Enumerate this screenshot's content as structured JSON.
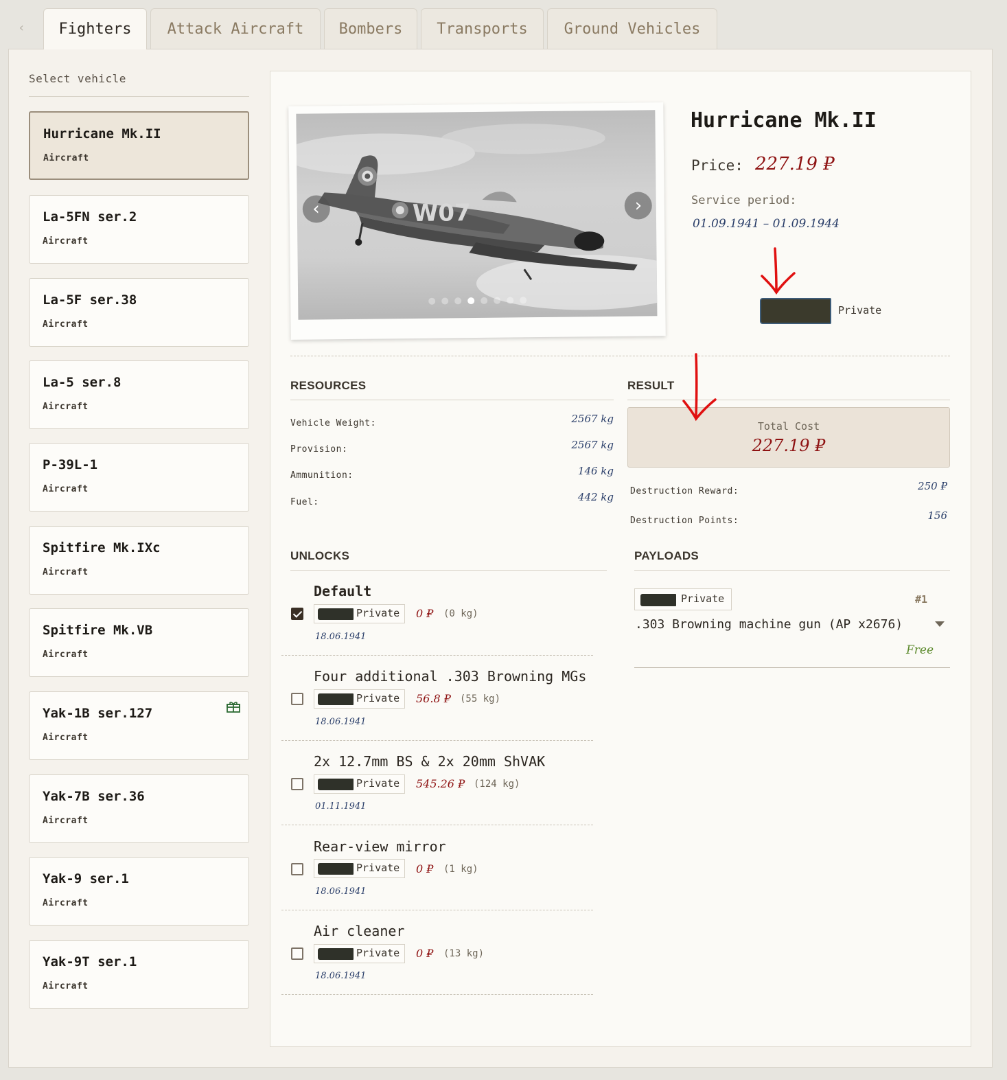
{
  "tabs": [
    {
      "label": "Fighters",
      "active": true
    },
    {
      "label": "Attack Aircraft",
      "active": false
    },
    {
      "label": "Bombers",
      "active": false
    },
    {
      "label": "Transports",
      "active": false
    },
    {
      "label": "Ground Vehicles",
      "active": false
    }
  ],
  "sidebar": {
    "heading": "Select vehicle",
    "vehicles": [
      {
        "name": "Hurricane Mk.II",
        "type": "Aircraft",
        "selected": true
      },
      {
        "name": "La-5FN ser.2",
        "type": "Aircraft"
      },
      {
        "name": "La-5F ser.38",
        "type": "Aircraft"
      },
      {
        "name": "La-5 ser.8",
        "type": "Aircraft"
      },
      {
        "name": "P-39L-1",
        "type": "Aircraft"
      },
      {
        "name": "Spitfire Mk.IXc",
        "type": "Aircraft"
      },
      {
        "name": "Spitfire Mk.VB",
        "type": "Aircraft"
      },
      {
        "name": "Yak-1B ser.127",
        "type": "Aircraft",
        "icon": "gift-icon"
      },
      {
        "name": "Yak-7B ser.36",
        "type": "Aircraft"
      },
      {
        "name": "Yak-9 ser.1",
        "type": "Aircraft"
      },
      {
        "name": "Yak-9T ser.1",
        "type": "Aircraft"
      }
    ]
  },
  "detail": {
    "title": "Hurricane Mk.II",
    "price_label": "Price:",
    "price_value": "227.19 ₽",
    "service_label": "Service period:",
    "service_value": "01.09.1941 – 01.09.1944",
    "rank_label": "Private",
    "gallery_slides": 8,
    "gallery_active_slide": 4
  },
  "resources": {
    "heading": "RESOURCES",
    "rows": [
      {
        "label": "Vehicle Weight:",
        "value": "2567 kg"
      },
      {
        "label": "Provision:",
        "value": "2567 kg"
      },
      {
        "label": "Ammunition:",
        "value": "146 kg"
      },
      {
        "label": "Fuel:",
        "value": "442 kg"
      }
    ]
  },
  "result": {
    "heading": "RESULT",
    "total_label": "Total Cost",
    "total_value": "227.19 ₽",
    "rows": [
      {
        "label": "Destruction Reward:",
        "value": "250 ₽"
      },
      {
        "label": "Destruction Points:",
        "value": "156"
      }
    ]
  },
  "unlocks": {
    "heading": "UNLOCKS",
    "items": [
      {
        "title": "Default",
        "rank": "Private",
        "price": "0 ₽",
        "weight": "(0 kg)",
        "date": "18.06.1941",
        "checked": true
      },
      {
        "title": "Four additional .303 Browning MGs",
        "rank": "Private",
        "price": "56.8 ₽",
        "weight": "(55 kg)",
        "date": "18.06.1941",
        "checked": false
      },
      {
        "title": "2x 12.7mm BS & 2x 20mm ShVAK",
        "rank": "Private",
        "price": "545.26 ₽",
        "weight": "(124 kg)",
        "date": "01.11.1941",
        "checked": false
      },
      {
        "title": "Rear-view mirror",
        "rank": "Private",
        "price": "0 ₽",
        "weight": "(1 kg)",
        "date": "18.06.1941",
        "checked": false
      },
      {
        "title": "Air cleaner",
        "rank": "Private",
        "price": "0 ₽",
        "weight": "(13 kg)",
        "date": "18.06.1941",
        "checked": false
      }
    ]
  },
  "payloads": {
    "heading": "PAYLOADS",
    "rank": "Private",
    "number": "#1",
    "name": ".303 Browning machine gun (AP x2676)",
    "cost": "Free"
  },
  "colors": {
    "price_red": "#8e1212",
    "date_blue": "#2b3f6a",
    "free_green": "#5c8a2d",
    "annotation_red": "#e01010"
  }
}
